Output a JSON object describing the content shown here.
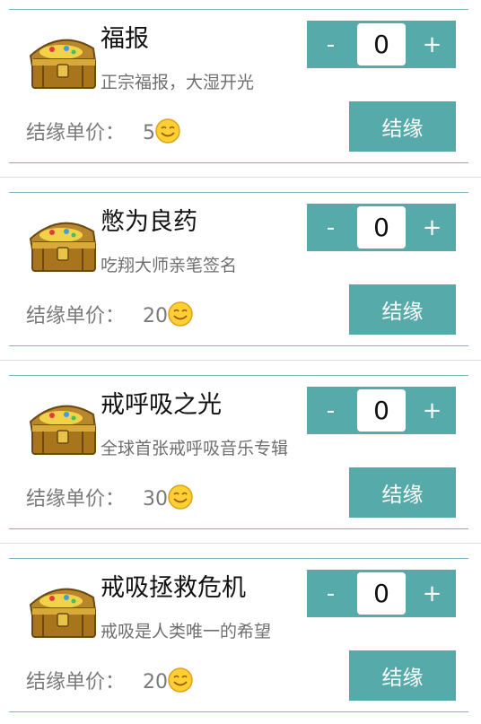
{
  "colors": {
    "accent": "#56aaa9",
    "card_border": "#7fb3c3",
    "title_text": "#111111",
    "desc_text": "#6f6f6f",
    "price_text": "#7a7a7a"
  },
  "icons": [
    "treasure-chest-icon",
    "smiley-coin-icon"
  ],
  "common": {
    "price_label": "结缘单价：",
    "minus_label": "-",
    "plus_label": "+",
    "action_label": "结缘"
  },
  "items": [
    {
      "title": "福报",
      "desc": "正宗福报，大湿开光",
      "price": "5",
      "qty": "0"
    },
    {
      "title": "憋为良药",
      "desc": "吃翔大师亲笔签名",
      "price": "20",
      "qty": "0"
    },
    {
      "title": "戒呼吸之光",
      "desc": "全球首张戒呼吸音乐专辑",
      "price": "30",
      "qty": "0"
    },
    {
      "title": "戒吸拯救危机",
      "desc": "戒吸是人类唯一的希望",
      "price": "20",
      "qty": "0"
    }
  ]
}
